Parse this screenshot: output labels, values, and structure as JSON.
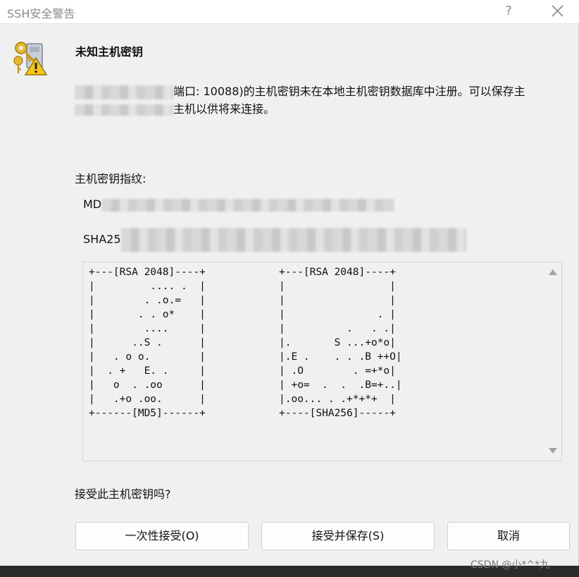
{
  "window": {
    "title": "SSH安全警告",
    "help_glyph": "?"
  },
  "header": {
    "heading": "未知主机密钥"
  },
  "message": {
    "line1": "端口: 10088)的主机密钥未在本地主机密钥数据库中注册。可以保存主",
    "line2": "主机以供将来连接。"
  },
  "fingerprint": {
    "label": "主机密钥指纹:",
    "md5_prefix": "MD",
    "sha256_prefix": "SHA25"
  },
  "randomart": {
    "md5": "+---[RSA 2048]----+\n|         .... .  |\n|        . .o.=   |\n|       . . o*    |\n|        ....     |\n|      ..S .      |\n|   . o o.        |\n|  . +   E. .     |\n|   o  . .oo      |\n|   .+o .oo.      |\n+------[MD5]------+",
    "sha256": "+---[RSA 2048]----+\n|                 |\n|                 |\n|               . |\n|          .   . .|\n|.       S ...+o*o|\n|.E .    . . .B ++O|\n| .O        . =+*o|\n| +o=  .  .  .B=+..|\n|.oo... . .+*+*+  |\n+----[SHA256]-----+"
  },
  "prompt": {
    "question": "接受此主机密钥吗?"
  },
  "buttons": {
    "accept_once": "一次性接受(O)",
    "accept_save": "接受并保存(S)",
    "cancel": "取消"
  },
  "watermark": "CSDN @小*^*九",
  "colors": {
    "dialog_bg": "#f0f0f0",
    "title_text": "#8a8a8a"
  },
  "icons": {
    "dialog": "key-warning-icon",
    "close": "close-icon",
    "scroll_up": "scroll-up-arrow-icon",
    "scroll_down": "scroll-down-arrow-icon"
  }
}
